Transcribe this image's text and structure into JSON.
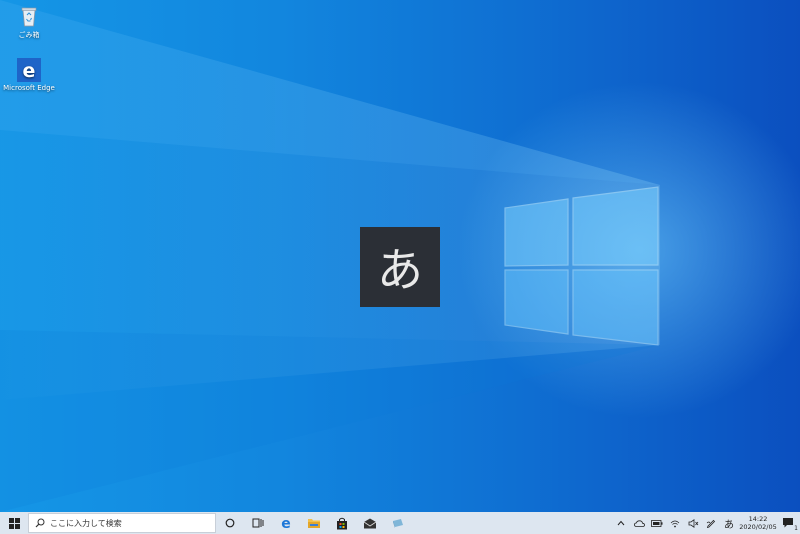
{
  "desktop": {
    "icons": [
      {
        "label": "ごみ箱",
        "icon": "recycle-bin-icon"
      },
      {
        "label": "Microsoft Edge",
        "icon": "edge-icon"
      }
    ],
    "ime_indicator_char": "あ"
  },
  "taskbar": {
    "search_placeholder": "ここに入力して検索",
    "pinned": [
      "cortana-icon",
      "task-view-icon",
      "edge-icon",
      "file-explorer-icon",
      "store-icon",
      "mail-icon",
      "app-icon"
    ],
    "tray": {
      "ime_label": "あ",
      "time": "14:22",
      "date": "2020/02/05",
      "notification_count": "1"
    }
  },
  "colors": {
    "desktop_blue": "#1286de",
    "taskbar_bg": "#dde6f0",
    "ime_popup_bg": "#2b2f36"
  }
}
